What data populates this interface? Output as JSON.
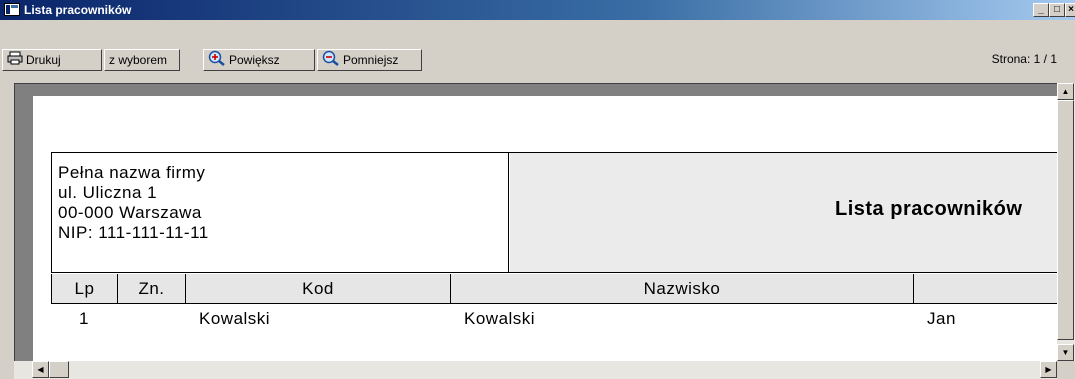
{
  "window": {
    "title": "Lista pracowników",
    "minimize_glyph": "_",
    "maximize_glyph": "□",
    "close_glyph": "×"
  },
  "toolbar": {
    "print_label": "Drukuj",
    "select_label": "z wyborem",
    "zoom_in_label": "Powiększ",
    "zoom_out_label": "Pomniejsz",
    "page_indicator": "Strona: 1 / 1"
  },
  "report": {
    "company": {
      "name": "Pełna nazwa firmy",
      "street": "ul. Uliczna 1",
      "city": "00-000 Warszawa",
      "nip": "NIP: 111-111-11-11"
    },
    "title": "Lista pracowników",
    "columns": [
      "Lp",
      "Zn.",
      "Kod",
      "Nazwisko",
      ""
    ],
    "rows": [
      {
        "lp": "1",
        "zn": "",
        "kod": "Kowalski",
        "nazwisko": "Kowalski",
        "imie": "Jan"
      }
    ]
  },
  "scroll": {
    "up": "▲",
    "down": "▼",
    "left": "◀",
    "right": "▶"
  }
}
